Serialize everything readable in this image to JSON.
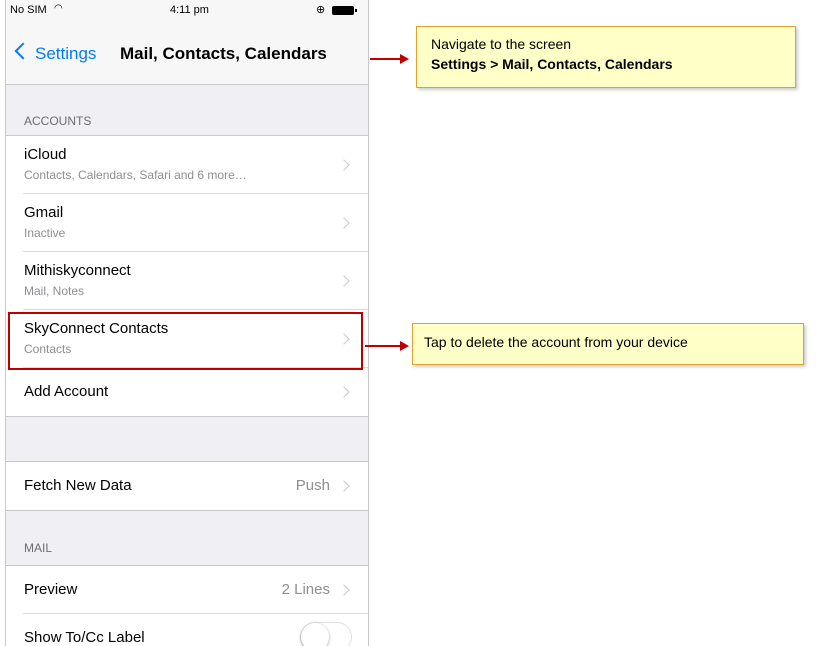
{
  "status_bar": {
    "carrier": "No SIM",
    "wifi_icon": "wifi-icon",
    "time": "4:11 pm",
    "lock_icon": "orientation-lock-icon",
    "battery_icon": "battery-icon"
  },
  "nav": {
    "back_label": "Settings",
    "title": "Mail, Contacts, Calendars"
  },
  "accounts_header": "ACCOUNTS",
  "accounts": [
    {
      "title": "iCloud",
      "subtitle": "Contacts, Calendars, Safari and 6 more…"
    },
    {
      "title": "Gmail",
      "subtitle": "Inactive"
    },
    {
      "title": "Mithiskyconnect",
      "subtitle": "Mail, Notes"
    },
    {
      "title": "SkyConnect Contacts",
      "subtitle": "Contacts"
    }
  ],
  "add_account": "Add Account",
  "fetch": {
    "title": "Fetch New Data",
    "value": "Push"
  },
  "mail_header": "MAIL",
  "mail": {
    "preview": {
      "title": "Preview",
      "value": "2 Lines"
    },
    "show_to_cc": {
      "title": "Show To/Cc Label",
      "on": false
    }
  },
  "callouts": {
    "navigate_line1": "Navigate  to the screen",
    "navigate_line2": "Settings > Mail, Contacts, Calendars",
    "delete_hint": "Tap to delete the account from your device"
  },
  "colors": {
    "ios_blue": "#007aff",
    "highlight_red": "#c00000",
    "callout_bg": "#ffffc8"
  }
}
